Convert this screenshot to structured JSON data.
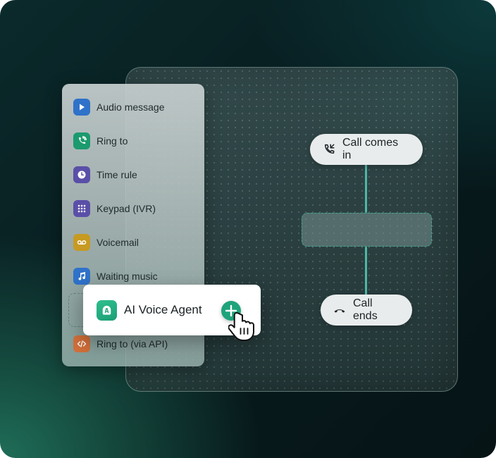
{
  "flow": {
    "start_node": {
      "label": "Call comes in",
      "icon": "phone-incoming-icon"
    },
    "end_node": {
      "label": "Call ends",
      "icon": "hang-up-icon"
    }
  },
  "sidebar": {
    "items": [
      {
        "label": "Audio message",
        "icon": "play-icon",
        "color": "#2f72c9"
      },
      {
        "label": "Ring to",
        "icon": "phone-ring-icon",
        "color": "#1b9a6e"
      },
      {
        "label": "Time rule",
        "icon": "clock-icon",
        "color": "#5a4fa8"
      },
      {
        "label": "Keypad (IVR)",
        "icon": "keypad-icon",
        "color": "#5a4fa8"
      },
      {
        "label": "Voicemail",
        "icon": "voicemail-icon",
        "color": "#c79a22"
      },
      {
        "label": "Waiting music",
        "icon": "music-note-icon",
        "color": "#2f72c9"
      },
      {
        "label": "Ring to (via API)",
        "icon": "code-icon",
        "color": "#d2703a"
      }
    ]
  },
  "drag_card": {
    "label": "AI Voice Agent",
    "icon": "ai-agent-icon",
    "color": "#1ea37a"
  },
  "colors": {
    "accent": "#1ea37a",
    "connector": "#4fb7a4"
  }
}
